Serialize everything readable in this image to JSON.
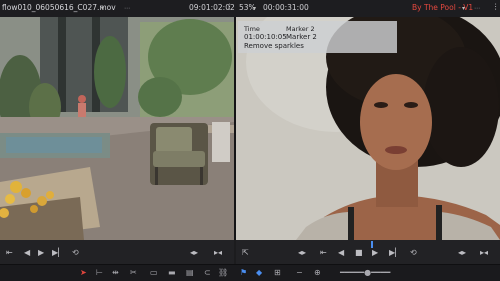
{
  "source_viewer": {
    "clip_name": "flow010_06050616_C027.mov",
    "timecode": "09:01:02:02"
  },
  "timeline_viewer": {
    "zoom": "53%",
    "timecode": "00:00:31:00",
    "timeline_name": "By The Pool - V1"
  },
  "marker_popup": {
    "time_header": "Time",
    "name_header": "Marker 2",
    "time_value": "01:00:10:05",
    "note": "Remove sparkles"
  },
  "colors": {
    "accent_red": "#e0453d",
    "playhead_blue": "#4a8ef0",
    "timeline_name_red": "#e4483f"
  },
  "icons": {
    "transport_left": [
      "in-point-icon",
      "step-back-icon",
      "play-icon",
      "step-forward-icon",
      "loop-icon"
    ],
    "transport_right": [
      "in-point-icon",
      "step-back-icon",
      "stop-icon",
      "play-icon",
      "step-forward-icon",
      "loop-icon"
    ],
    "toolbar": [
      "pointer-icon",
      "trim-icon",
      "dynamic-trim-icon",
      "blade-icon",
      "snapping-icon",
      "link-icon",
      "flag-icon",
      "marker-icon",
      "zoom-icon"
    ]
  }
}
